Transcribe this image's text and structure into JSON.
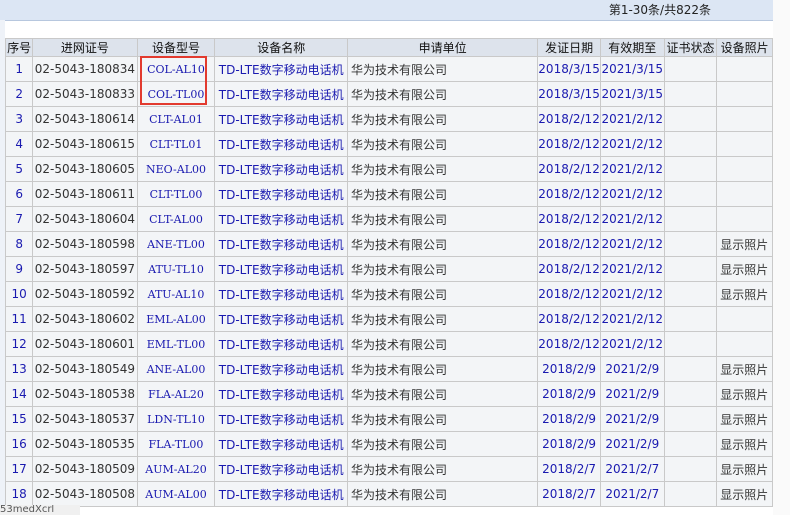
{
  "pager_text": "第1-30条/共822条",
  "headers": [
    "序号",
    "进网证号",
    "设备型号",
    "设备名称",
    "申请单位",
    "发证日期",
    "有效期至",
    "证书状态",
    "设备照片"
  ],
  "rows": [
    {
      "no": "1",
      "cert": "02-5043-180834",
      "model": "COL-AL10",
      "name": "TD-LTE数字移动电话机",
      "applicant": "华为技术有限公司",
      "issued": "2018/3/15",
      "valid": "2021/3/15",
      "status": "",
      "photo": ""
    },
    {
      "no": "2",
      "cert": "02-5043-180833",
      "model": "COL-TL00",
      "name": "TD-LTE数字移动电话机",
      "applicant": "华为技术有限公司",
      "issued": "2018/3/15",
      "valid": "2021/3/15",
      "status": "",
      "photo": ""
    },
    {
      "no": "3",
      "cert": "02-5043-180614",
      "model": "CLT-AL01",
      "name": "TD-LTE数字移动电话机",
      "applicant": "华为技术有限公司",
      "issued": "2018/2/12",
      "valid": "2021/2/12",
      "status": "",
      "photo": ""
    },
    {
      "no": "4",
      "cert": "02-5043-180615",
      "model": "CLT-TL01",
      "name": "TD-LTE数字移动电话机",
      "applicant": "华为技术有限公司",
      "issued": "2018/2/12",
      "valid": "2021/2/12",
      "status": "",
      "photo": ""
    },
    {
      "no": "5",
      "cert": "02-5043-180605",
      "model": "NEO-AL00",
      "name": "TD-LTE数字移动电话机",
      "applicant": "华为技术有限公司",
      "issued": "2018/2/12",
      "valid": "2021/2/12",
      "status": "",
      "photo": ""
    },
    {
      "no": "6",
      "cert": "02-5043-180611",
      "model": "CLT-TL00",
      "name": "TD-LTE数字移动电话机",
      "applicant": "华为技术有限公司",
      "issued": "2018/2/12",
      "valid": "2021/2/12",
      "status": "",
      "photo": ""
    },
    {
      "no": "7",
      "cert": "02-5043-180604",
      "model": "CLT-AL00",
      "name": "TD-LTE数字移动电话机",
      "applicant": "华为技术有限公司",
      "issued": "2018/2/12",
      "valid": "2021/2/12",
      "status": "",
      "photo": ""
    },
    {
      "no": "8",
      "cert": "02-5043-180598",
      "model": "ANE-TL00",
      "name": "TD-LTE数字移动电话机",
      "applicant": "华为技术有限公司",
      "issued": "2018/2/12",
      "valid": "2021/2/12",
      "status": "",
      "photo": "显示照片"
    },
    {
      "no": "9",
      "cert": "02-5043-180597",
      "model": "ATU-TL10",
      "name": "TD-LTE数字移动电话机",
      "applicant": "华为技术有限公司",
      "issued": "2018/2/12",
      "valid": "2021/2/12",
      "status": "",
      "photo": "显示照片"
    },
    {
      "no": "10",
      "cert": "02-5043-180592",
      "model": "ATU-AL10",
      "name": "TD-LTE数字移动电话机",
      "applicant": "华为技术有限公司",
      "issued": "2018/2/12",
      "valid": "2021/2/12",
      "status": "",
      "photo": "显示照片"
    },
    {
      "no": "11",
      "cert": "02-5043-180602",
      "model": "EML-AL00",
      "name": "TD-LTE数字移动电话机",
      "applicant": "华为技术有限公司",
      "issued": "2018/2/12",
      "valid": "2021/2/12",
      "status": "",
      "photo": ""
    },
    {
      "no": "12",
      "cert": "02-5043-180601",
      "model": "EML-TL00",
      "name": "TD-LTE数字移动电话机",
      "applicant": "华为技术有限公司",
      "issued": "2018/2/12",
      "valid": "2021/2/12",
      "status": "",
      "photo": ""
    },
    {
      "no": "13",
      "cert": "02-5043-180549",
      "model": "ANE-AL00",
      "name": "TD-LTE数字移动电话机",
      "applicant": "华为技术有限公司",
      "issued": "2018/2/9",
      "valid": "2021/2/9",
      "status": "",
      "photo": "显示照片"
    },
    {
      "no": "14",
      "cert": "02-5043-180538",
      "model": "FLA-AL20",
      "name": "TD-LTE数字移动电话机",
      "applicant": "华为技术有限公司",
      "issued": "2018/2/9",
      "valid": "2021/2/9",
      "status": "",
      "photo": "显示照片"
    },
    {
      "no": "15",
      "cert": "02-5043-180537",
      "model": "LDN-TL10",
      "name": "TD-LTE数字移动电话机",
      "applicant": "华为技术有限公司",
      "issued": "2018/2/9",
      "valid": "2021/2/9",
      "status": "",
      "photo": "显示照片"
    },
    {
      "no": "16",
      "cert": "02-5043-180535",
      "model": "FLA-TL00",
      "name": "TD-LTE数字移动电话机",
      "applicant": "华为技术有限公司",
      "issued": "2018/2/9",
      "valid": "2021/2/9",
      "status": "",
      "photo": "显示照片"
    },
    {
      "no": "17",
      "cert": "02-5043-180509",
      "model": "AUM-AL20",
      "name": "TD-LTE数字移动电话机",
      "applicant": "华为技术有限公司",
      "issued": "2018/2/7",
      "valid": "2021/2/7",
      "status": "",
      "photo": "显示照片"
    },
    {
      "no": "18",
      "cert": "02-5043-180508",
      "model": "AUM-AL00",
      "name": "TD-LTE数字移动电话机",
      "applicant": "华为技术有限公司",
      "issued": "2018/2/7",
      "valid": "2021/2/7",
      "status": "",
      "photo": "显示照片"
    }
  ],
  "bottom_fragment": "53medXcrl",
  "colors": {
    "highlight": "#e23a2e",
    "link_blue": "#1a1ab0",
    "header_bg": "#dde3ec"
  }
}
